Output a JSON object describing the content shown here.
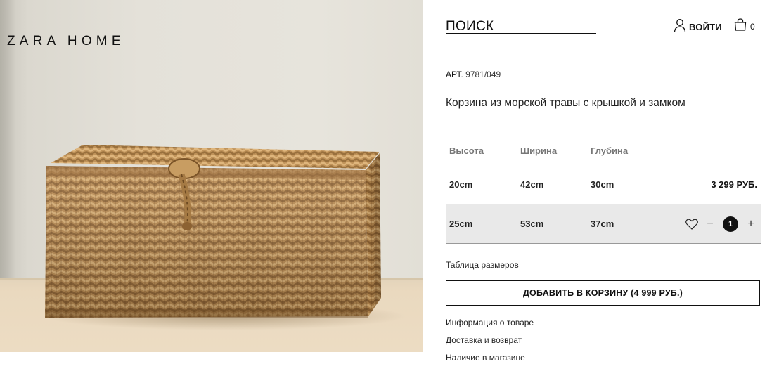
{
  "brand": {
    "logo_text": "ZARA HOME"
  },
  "header": {
    "search_label": "ПОИСК",
    "login_label": "ВОЙТИ",
    "cart_count": "0",
    "icons": {
      "user": "user-icon",
      "cart": "shopping-bag-icon"
    }
  },
  "product": {
    "ref_label": "АРТ.",
    "ref_value": "9781/049",
    "title": "Корзина из морской травы с крышкой и замком",
    "image_alt": "seagrass-basket-with-lid"
  },
  "size_table": {
    "headers": [
      "Высота",
      "Ширина",
      "Глубина"
    ],
    "rows": [
      {
        "height": "20cm",
        "width": "42cm",
        "depth": "30cm",
        "price": "3 299 РУБ.",
        "selected": false
      },
      {
        "height": "25cm",
        "width": "53cm",
        "depth": "37cm",
        "price": "",
        "selected": true,
        "quantity": "1"
      }
    ]
  },
  "actions": {
    "size_guide": "Таблица размеров",
    "add_to_cart": "ДОБАВИТЬ В КОРЗИНУ (4 999 РУБ.)",
    "minus": "−",
    "plus": "+"
  },
  "info_links": [
    "Информация о товаре",
    "Доставка и возврат",
    "Наличие в магазине"
  ],
  "colors": {
    "text": "#111111",
    "selected_row_bg": "#e9e9e9",
    "qty_badge": "#111111"
  }
}
